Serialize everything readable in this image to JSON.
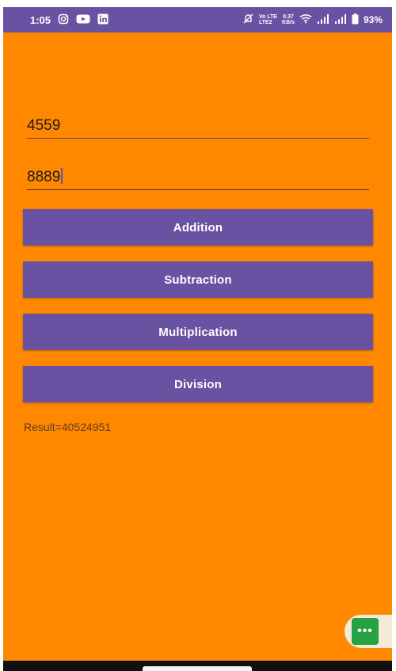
{
  "status_bar": {
    "time": "1:05",
    "left_icons": [
      "instagram-icon",
      "youtube-icon",
      "linkedin-icon"
    ],
    "network_label_top": "Vo LTE",
    "network_label_bottom": "LTE2",
    "speed_value": "0.37",
    "speed_unit": "KB/s",
    "battery_percent": "93%"
  },
  "inputs": {
    "first_number": "4559",
    "second_number": "8889"
  },
  "buttons": {
    "addition": "Addition",
    "subtraction": "Subtraction",
    "multiplication": "Multiplication",
    "division": "Division"
  },
  "result_text": "Result=40524951",
  "floating_button": {
    "label": "•••"
  },
  "colors": {
    "background": "#FF8800",
    "primary": "#6A52A2",
    "fab": "#25A244"
  }
}
